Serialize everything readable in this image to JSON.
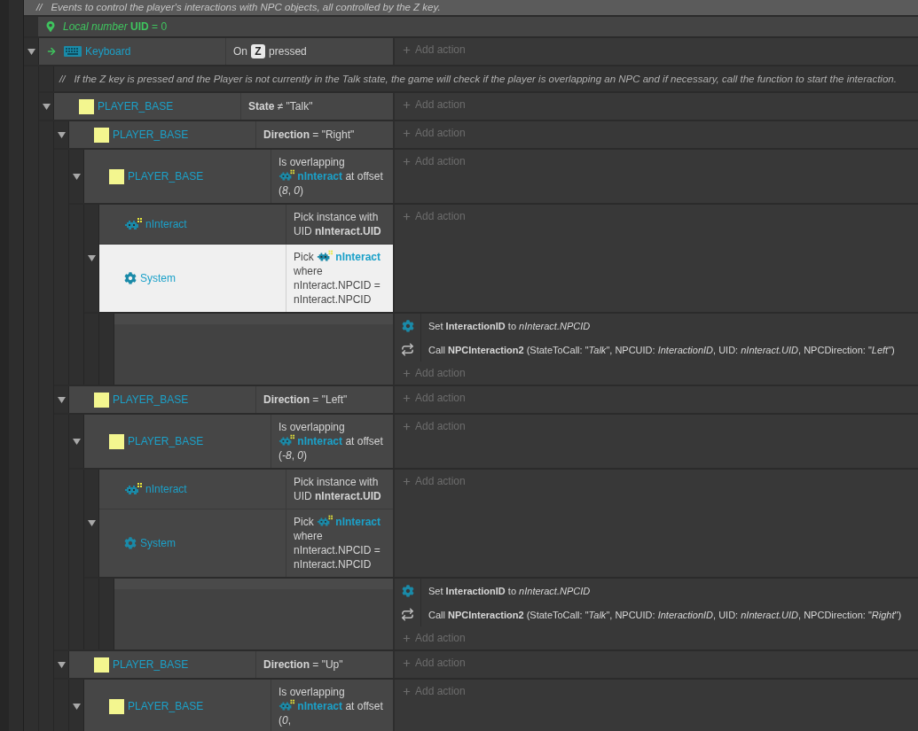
{
  "top_comment": {
    "marker": "//",
    "text": "Events to control the player's interactions with NPC objects, all controlled by the Z key."
  },
  "local_variable": "*Local number* **UID** = 0",
  "events": [
    {
      "kind": "event",
      "expanded": true,
      "add_action": "Add action",
      "conditions": [
        {
          "kind": "keyboard",
          "trigger": true,
          "selected": false,
          "object": "Keyboard",
          "text": [
            {
              "kind": "text",
              "text": "On"
            },
            {
              "kind": "key",
              "text": "Z"
            },
            {
              "kind": "text",
              "text": "pressed"
            }
          ]
        }
      ],
      "children": [
        {
          "kind": "comment",
          "marker": "//",
          "text": "If the Z key is pressed and the Player is not currently in the Talk state, the game will check if the player is overlapping an NPC and if necessary, call the function to start the interaction."
        },
        {
          "kind": "event",
          "expanded": true,
          "add_action": "Add action",
          "conditions": [
            {
              "kind": "sprite",
              "trigger": false,
              "selected": false,
              "object": "PLAYER_BASE",
              "text": [
                {
                  "kind": "text",
                  "text": "**State** ≠ \"Talk\""
                }
              ]
            }
          ],
          "children": [
            {
              "kind": "event",
              "expanded": true,
              "add_action": "Add action",
              "conditions": [
                {
                  "kind": "sprite",
                  "trigger": false,
                  "selected": false,
                  "object": "PLAYER_BASE",
                  "text": [
                    {
                      "kind": "text",
                      "text": "**Direction** = \"Right\""
                    }
                  ]
                }
              ],
              "children": [
                {
                  "kind": "event",
                  "expanded": true,
                  "add_action": "Add action",
                  "conditions": [
                    {
                      "kind": "sprite",
                      "trigger": false,
                      "selected": false,
                      "object": "PLAYER_BASE",
                      "text": [
                        {
                          "kind": "text",
                          "text": "Is overlapping"
                        },
                        {
                          "kind": "object",
                          "text": "nInteract"
                        },
                        {
                          "kind": "text",
                          "text": "at offset (*8*, *0*)"
                        }
                      ]
                    }
                  ],
                  "children": [
                    {
                      "kind": "event",
                      "expanded": true,
                      "add_action": "Add action",
                      "conditions": [
                        {
                          "kind": "family",
                          "trigger": false,
                          "selected": false,
                          "object": "nInteract",
                          "text": [
                            {
                              "kind": "text",
                              "text": "Pick instance with UID **nInteract.UID**"
                            }
                          ]
                        },
                        {
                          "kind": "system",
                          "trigger": false,
                          "selected": true,
                          "object": "System",
                          "text": [
                            {
                              "kind": "text",
                              "text": "Pick"
                            },
                            {
                              "kind": "object",
                              "text": "nInteract"
                            },
                            {
                              "kind": "text",
                              "text": "where nInteract.NPCID = nInteract.NPCID"
                            }
                          ]
                        }
                      ],
                      "children": [
                        {
                          "kind": "event",
                          "add_action": "Add action",
                          "actions": [
                            {
                              "kind": "system",
                              "text": "Set **InteractionID** to *nInteract.NPCID*"
                            },
                            {
                              "kind": "function",
                              "text": "Call **NPCInteraction2** (StateToCall: \"*Talk*\", NPCUID: *InteractionID*, UID: *nInteract.UID*, NPCDirection: \"*Left*\")"
                            }
                          ]
                        }
                      ]
                    }
                  ]
                }
              ]
            },
            {
              "kind": "event",
              "expanded": true,
              "add_action": "Add action",
              "conditions": [
                {
                  "kind": "sprite",
                  "trigger": false,
                  "selected": false,
                  "object": "PLAYER_BASE",
                  "text": [
                    {
                      "kind": "text",
                      "text": "**Direction** = \"Left\""
                    }
                  ]
                }
              ],
              "children": [
                {
                  "kind": "event",
                  "expanded": true,
                  "add_action": "Add action",
                  "conditions": [
                    {
                      "kind": "sprite",
                      "trigger": false,
                      "selected": false,
                      "object": "PLAYER_BASE",
                      "text": [
                        {
                          "kind": "text",
                          "text": "Is overlapping"
                        },
                        {
                          "kind": "object",
                          "text": "nInteract"
                        },
                        {
                          "kind": "text",
                          "text": "at offset (*-8*, *0*)"
                        }
                      ]
                    }
                  ],
                  "children": [
                    {
                      "kind": "event",
                      "expanded": true,
                      "add_action": "Add action",
                      "conditions": [
                        {
                          "kind": "family",
                          "trigger": false,
                          "selected": false,
                          "object": "nInteract",
                          "text": [
                            {
                              "kind": "text",
                              "text": "Pick instance with UID **nInteract.UID**"
                            }
                          ]
                        },
                        {
                          "kind": "system",
                          "trigger": false,
                          "selected": false,
                          "object": "System",
                          "text": [
                            {
                              "kind": "text",
                              "text": "Pick"
                            },
                            {
                              "kind": "object",
                              "text": "nInteract"
                            },
                            {
                              "kind": "text",
                              "text": "where nInteract.NPCID = nInteract.NPCID"
                            }
                          ]
                        }
                      ],
                      "children": [
                        {
                          "kind": "event",
                          "add_action": "Add action",
                          "actions": [
                            {
                              "kind": "system",
                              "text": "Set **InteractionID** to *nInteract.NPCID*"
                            },
                            {
                              "kind": "function",
                              "text": "Call **NPCInteraction2** (StateToCall: \"*Talk*\", NPCUID: *InteractionID*, UID: *nInteract.UID*, NPCDirection: \"*Right*\")"
                            }
                          ]
                        }
                      ]
                    }
                  ]
                }
              ]
            },
            {
              "kind": "event",
              "expanded": true,
              "add_action": "Add action",
              "conditions": [
                {
                  "kind": "sprite",
                  "trigger": false,
                  "selected": false,
                  "object": "PLAYER_BASE",
                  "text": [
                    {
                      "kind": "text",
                      "text": "**Direction** = \"Up\""
                    }
                  ]
                }
              ],
              "children": [
                {
                  "kind": "event",
                  "expanded": true,
                  "add_action": "Add action",
                  "conditions": [
                    {
                      "kind": "sprite",
                      "trigger": false,
                      "selected": false,
                      "object": "PLAYER_BASE",
                      "text": [
                        {
                          "kind": "text",
                          "text": "Is overlapping"
                        },
                        {
                          "kind": "object",
                          "text": "nInteract"
                        },
                        {
                          "kind": "text",
                          "text": "at offset (*0*,"
                        }
                      ]
                    }
                  ]
                }
              ]
            }
          ]
        }
      ]
    }
  ]
}
